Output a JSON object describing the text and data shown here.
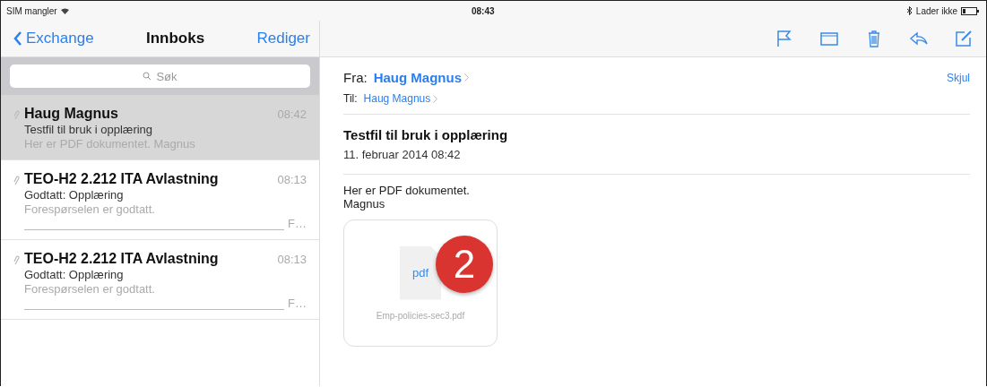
{
  "status_bar": {
    "carrier": "SIM mangler",
    "time": "08:43",
    "battery_text": "Lader ikke"
  },
  "sidebar": {
    "back_label": "Exchange",
    "title": "Innboks",
    "edit_label": "Rediger",
    "search": {
      "placeholder": "Søk"
    },
    "messages": [
      {
        "from": "Haug Magnus",
        "time": "08:42",
        "subject": "Testfil til bruk i opplæring",
        "preview": "Her er PDF dokumentet. Magnus",
        "selected": true
      },
      {
        "from": "TEO-H2 2.212 ITA Avlastning",
        "time": "08:13",
        "subject": "Godtatt: Opplæring",
        "preview": "Forespørselen er godtatt.",
        "preview_tail": "F…",
        "selected": false
      },
      {
        "from": "TEO-H2 2.212 ITA Avlastning",
        "time": "08:13",
        "subject": "Godtatt: Opplæring",
        "preview": "Forespørselen er godtatt.",
        "preview_tail": "F…",
        "selected": false
      }
    ]
  },
  "message": {
    "from_label": "Fra:",
    "from": "Haug Magnus",
    "hide_label": "Skjul",
    "to_label": "Til:",
    "to": "Haug Magnus",
    "subject": "Testfil til bruk i opplæring",
    "date": "11. februar 2014 08:42",
    "body": [
      "Her er PDF dokumentet.",
      "Magnus"
    ],
    "attachment": {
      "type_label": "pdf",
      "filename": "Emp-policies-sec3.pdf"
    }
  },
  "callout": {
    "number": "2"
  }
}
